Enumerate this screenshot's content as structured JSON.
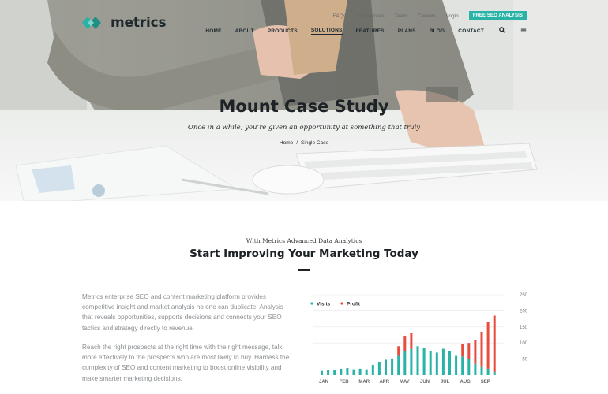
{
  "brand": {
    "name": "metrics",
    "accent": "#28b3a6",
    "profit_color": "#e74c3c"
  },
  "topbar": {
    "links": [
      "FAQs",
      "Testimonials",
      "Team",
      "Careers",
      "Login"
    ],
    "cta": "FREE SEO ANALYSIS"
  },
  "nav": {
    "items": [
      "HOME",
      "ABOUT",
      "PRODUCTS",
      "SOLUTIONS",
      "FEATURES",
      "PLANS",
      "BLOG",
      "CONTACT"
    ],
    "active": "SOLUTIONS",
    "icons": [
      "search-icon",
      "menu-icon"
    ]
  },
  "hero": {
    "title": "Mount Case Study",
    "subtitle": "Once in a while, you’re given an opportunity at something that truly",
    "breadcrumb": {
      "home": "Home",
      "separator": "/",
      "current": "Single Case"
    }
  },
  "section": {
    "eyebrow": "With Metrics Advanced Data Analytics",
    "title": "Start Improving Your Marketing Today",
    "paragraph1": "Metrics enterprise SEO and content marketing platform provides competitive insight and market analysis no one can duplicate. Analysis that reveals opportunities, supports decisions and connects your SEO tactics and strategy directly to revenue.",
    "paragraph2": "Reach the right prospects at the right time with the right message, talk more effectively to the prospects who are most likely to buy. Harness the complexity of SEO and content marketing to boost online visibility and make smarter marketing decisions."
  },
  "chart_data": {
    "type": "bar",
    "stacked": true,
    "legend_position": "top-left",
    "series": [
      {
        "name": "Visits",
        "color": "#28b3a6",
        "values": [
          13,
          15,
          17,
          20,
          22,
          18,
          20,
          18,
          32,
          40,
          48,
          52,
          60,
          75,
          82,
          90,
          85,
          75,
          70,
          82,
          75,
          60,
          58,
          50,
          35,
          25,
          20,
          10
        ]
      },
      {
        "name": "Profit",
        "color": "#e74c3c",
        "values": [
          0,
          0,
          0,
          0,
          0,
          0,
          0,
          0,
          0,
          0,
          0,
          0,
          30,
          45,
          50,
          0,
          0,
          0,
          0,
          0,
          0,
          0,
          40,
          50,
          75,
          110,
          145,
          175
        ]
      }
    ],
    "month_labels": [
      "JAN",
      "FEB",
      "MAR",
      "APR",
      "MAY",
      "JUN",
      "JUL",
      "AUG",
      "SEP"
    ],
    "y_ticks": [
      50,
      100,
      150,
      200,
      250
    ],
    "ylim": [
      0,
      250
    ],
    "y_axis_side": "right",
    "grid": true
  }
}
